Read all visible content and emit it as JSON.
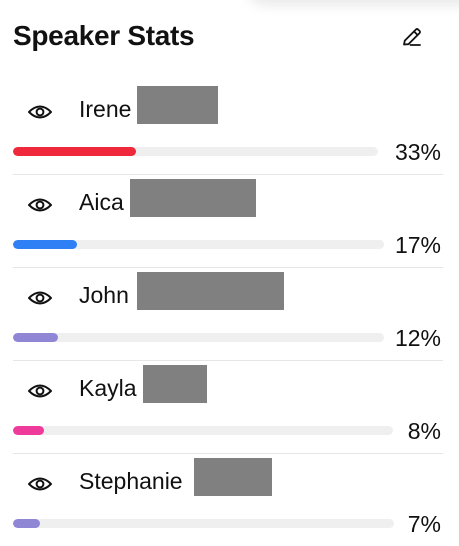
{
  "panel": {
    "title": "Speaker Stats",
    "edit_icon": "pencil-icon"
  },
  "speakers": [
    {
      "name": "Irene",
      "percent_label": "33%",
      "share": 0.33,
      "color": "#f0283c",
      "icon": "eye-icon",
      "name_redacted": true
    },
    {
      "name": "Aica",
      "percent_label": "17%",
      "share": 0.17,
      "color": "#2f80f5",
      "icon": "eye-icon",
      "name_redacted": true
    },
    {
      "name": "John",
      "percent_label": "12%",
      "share": 0.12,
      "color": "#8f87d6",
      "icon": "eye-icon",
      "name_redacted": true
    },
    {
      "name": "Kayla",
      "percent_label": "8%",
      "share": 0.08,
      "color": "#ee3a9a",
      "icon": "eye-icon",
      "name_redacted": true
    },
    {
      "name": "Stephanie",
      "percent_label": "7%",
      "share": 0.07,
      "color": "#8f87d6",
      "icon": "eye-icon",
      "name_redacted": true
    }
  ]
}
